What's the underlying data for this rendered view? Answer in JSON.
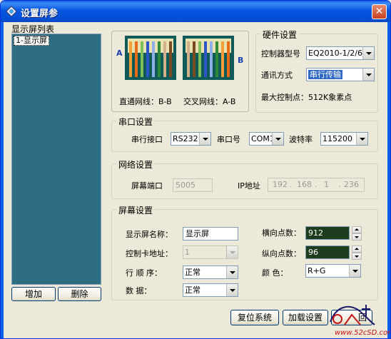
{
  "window": {
    "title": "设置屏参",
    "close_glyph": "✕"
  },
  "list": {
    "label": "显示屏列表",
    "items": [
      "1-显示屏"
    ]
  },
  "buttons": {
    "add": "增加",
    "delete": "删除",
    "reset": "复位系统",
    "load": "加载设置",
    "back": "回"
  },
  "cable": {
    "left_letter": "A",
    "right_letter": "B",
    "straight_label": "直通网线：B-B",
    "cross_label": "交叉网线：A-B"
  },
  "hardware": {
    "title": "硬件设置",
    "model_label": "控制器型号",
    "model_value": "EQ2010-1/2/6",
    "comm_label": "通讯方式",
    "comm_value": "串行传输",
    "max_points": "最大控制点：512K象素点"
  },
  "serial": {
    "title": "串口设置",
    "port_label": "串行接口",
    "port_value": "RS232",
    "com_label": "串口号",
    "com_value": "COM1",
    "baud_label": "波特率",
    "baud_value": "115200"
  },
  "network": {
    "title": "网络设置",
    "port_label": "屏幕端口",
    "port_value": "5005",
    "ip_label": "IP地址",
    "ip_segments": [
      "192",
      "168",
      "1",
      "236"
    ]
  },
  "screen": {
    "title": "屏幕设置",
    "name_label": "显示屏名称：",
    "name_value": "显示屏",
    "addr_label": "控制卡地址：",
    "addr_value": "1",
    "order_label": "行  顺  序：",
    "order_value": "正常",
    "data_label": "数      据：",
    "data_value": "正常",
    "h_label": "横向点数：",
    "h_value": "912",
    "v_label": "纵向点数：",
    "v_value": "96",
    "color_label": "颜      色：",
    "color_value": "R+G"
  },
  "watermark": {
    "text": "www.52cSD.com"
  },
  "colors": {
    "title_bar": "#0556e1",
    "list_bg": "#2e6e84",
    "selection": "#316ac5",
    "dark_field": "#1e3c1e"
  }
}
